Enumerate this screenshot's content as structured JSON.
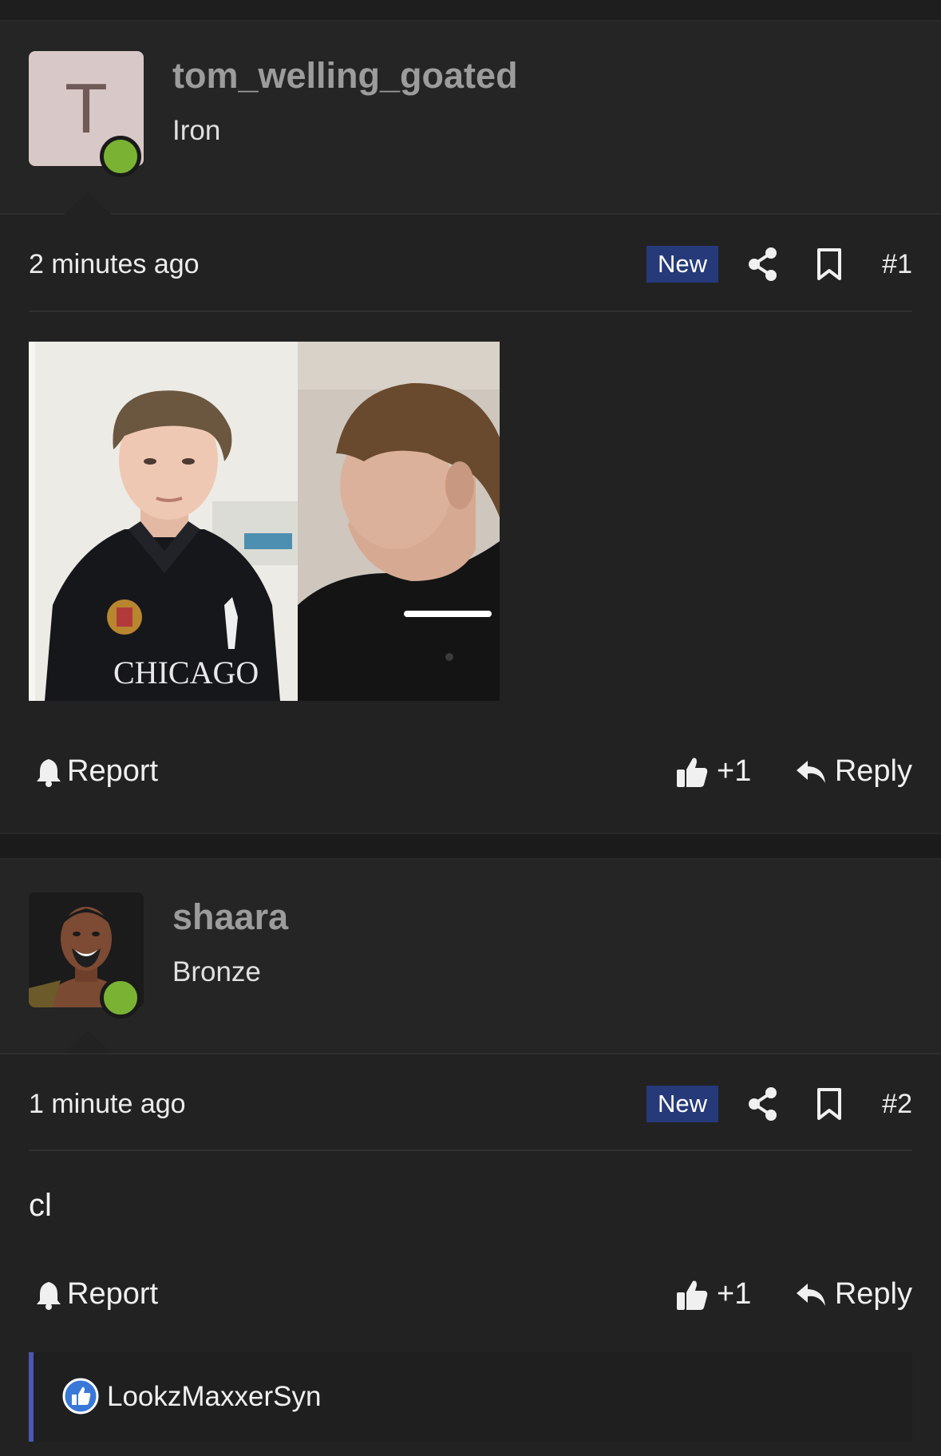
{
  "posts": [
    {
      "username": "tom_welling_goated",
      "rank": "Iron",
      "avatar_letter": "T",
      "time": "2 minutes ago",
      "badge": "New",
      "number": "#1",
      "shirt_text": "CHICAGO",
      "actions": {
        "report": "Report",
        "likes": "+1",
        "reply": "Reply"
      }
    },
    {
      "username": "shaara",
      "rank": "Bronze",
      "time": "1 minute ago",
      "badge": "New",
      "number": "#2",
      "body": "cl",
      "actions": {
        "report": "Report",
        "likes": "+1",
        "reply": "Reply"
      }
    }
  ],
  "reactions": {
    "user": "LookzMaxxerSyn"
  },
  "colors": {
    "online": "#7ab333",
    "badge": "#263a7a",
    "accent": "#4b56b5"
  }
}
